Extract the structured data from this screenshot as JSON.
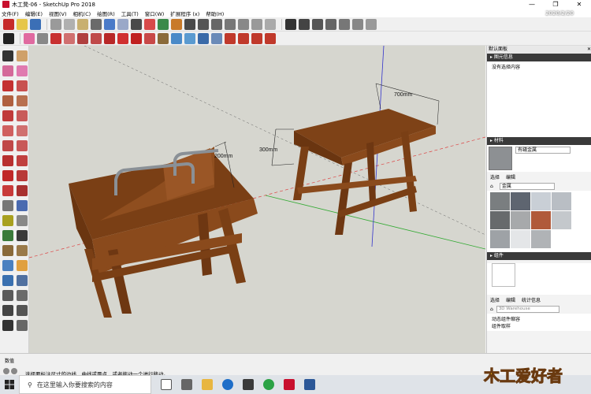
{
  "window": {
    "title": "木工凳-06 - SketchUp Pro 2018",
    "controls": [
      "—",
      "❐",
      "✕"
    ]
  },
  "menu": [
    "文件(F)",
    "编辑(E)",
    "视图(V)",
    "相机(C)",
    "绘图(R)",
    "工具(T)",
    "窗口(W)",
    "扩展程序 (x)",
    "帮助(H)"
  ],
  "viewport": {
    "dimensions": [
      "700mm",
      "300mm",
      "200mm"
    ]
  },
  "tray": {
    "title": "默认面板",
    "entity_info": {
      "header": "▸ 图元信息",
      "body": "没有选择内容"
    },
    "materials": {
      "header": "▸ 材料",
      "name": "有缝金属",
      "tabs": [
        "选择",
        "编辑"
      ],
      "category": "金属",
      "swatch_colors": [
        "#7a7e80",
        "#5e6570",
        "#c9cfd6",
        "#b9bec4",
        "#676a6c",
        "#a7a9ab",
        "#b05a3a",
        "#c4c8cc",
        "#9ea2a6",
        "#e4e6e8",
        "#b0b3b6"
      ]
    },
    "components": {
      "header": "▸ 组件",
      "tabs": [
        "选择",
        "编辑",
        "统计信息"
      ],
      "search_placeholder": "3D Warehouse",
      "text1": "动态组件缩容",
      "text2": "组件取样"
    }
  },
  "status": {
    "vcb_label": "数值",
    "hint": "选择要标注尺寸的边线、曲线或两点，或者拖动一个进行移动。"
  },
  "taskbar": {
    "search_placeholder": "在这里输入你要搜索的内容",
    "watermark": "木工爱好者",
    "date": "2020/2/20"
  },
  "colors": {
    "wood": "#8a4a1c",
    "wood_dark": "#5c2f0f",
    "viewport_bg": "#d6d6cf",
    "panel_header": "#3a3a3a"
  }
}
